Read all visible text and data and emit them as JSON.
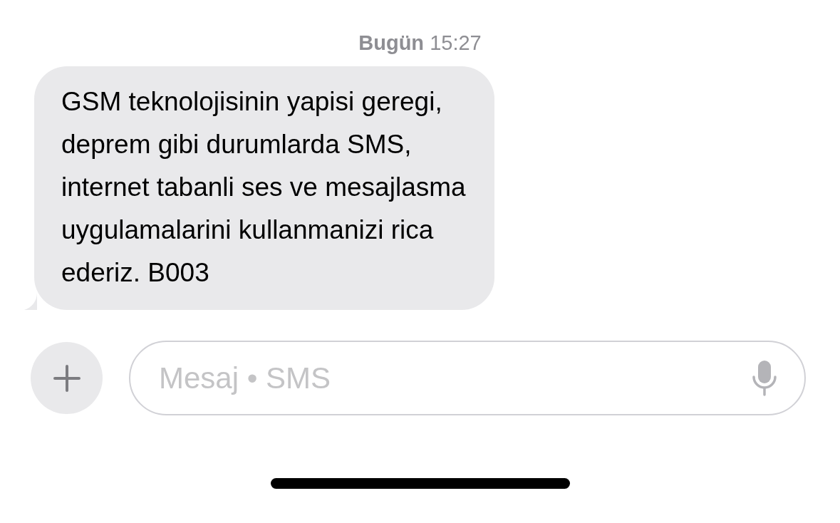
{
  "timestamp": "**Bugün** 15:27",
  "messages": [
    {
      "kind": "incoming",
      "text": "GSM teknolojisinin yapisi geregi,\ndeprem gibi durumlarda SMS,\ninternet tabanli ses ve mesajlasma\nuygulamalarini kullanmanizi rica\nederiz. B003"
    }
  ],
  "composer": {
    "placeholder": "Mesaj • SMS"
  }
}
